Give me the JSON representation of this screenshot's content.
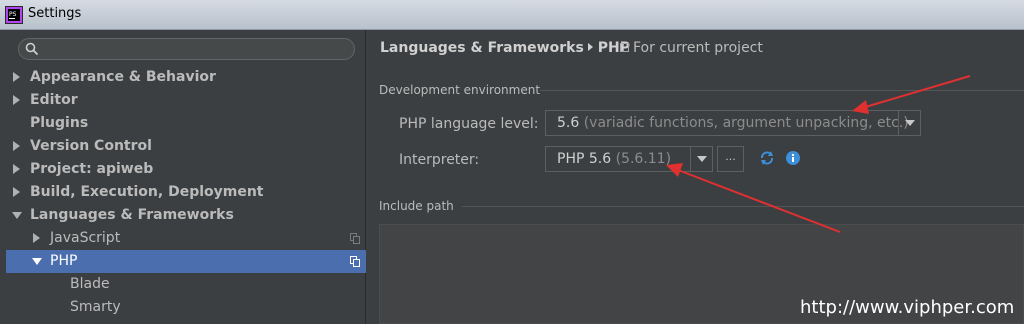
{
  "window": {
    "title": "Settings",
    "icon": "phpstorm-app-icon"
  },
  "search": {
    "icon": "search-icon",
    "placeholder": ""
  },
  "tree": [
    {
      "label": "Appearance & Behavior",
      "expanded": false,
      "bold": true
    },
    {
      "label": "Editor",
      "expanded": false,
      "bold": true
    },
    {
      "label": "Plugins",
      "bold": true
    },
    {
      "label": "Version Control",
      "expanded": false,
      "bold": true
    },
    {
      "label": "Project: apiweb",
      "expanded": false,
      "bold": true
    },
    {
      "label": "Build, Execution, Deployment",
      "expanded": false,
      "bold": true
    },
    {
      "label": "Languages & Frameworks",
      "expanded": true,
      "bold": true
    },
    {
      "label": "JavaScript",
      "expanded": false,
      "project_scoped": true
    },
    {
      "label": "PHP",
      "expanded": true,
      "selected": true,
      "project_scoped": true
    },
    {
      "label": "Blade"
    },
    {
      "label": "Smarty"
    }
  ],
  "header": {
    "breadcrumb": [
      "Languages & Frameworks",
      "PHP"
    ],
    "scope_label": "For current project"
  },
  "dev_env": {
    "section_title": "Development environment",
    "language_level_label": "PHP language level:",
    "language_level_value": "5.6",
    "language_level_hint": "(variadic functions, argument unpacking, etc.)",
    "interpreter_label": "Interpreter:",
    "interpreter_value": "PHP 5.6",
    "interpreter_version": "(5.6.11)",
    "browse_label": "..."
  },
  "include_path": {
    "section_title": "Include path"
  },
  "watermark": "http://www.viphper.com",
  "colors": {
    "selection": "#4b6eaf",
    "annotation_arrow": "#e03030",
    "info_icon": "#3d8fd8"
  }
}
